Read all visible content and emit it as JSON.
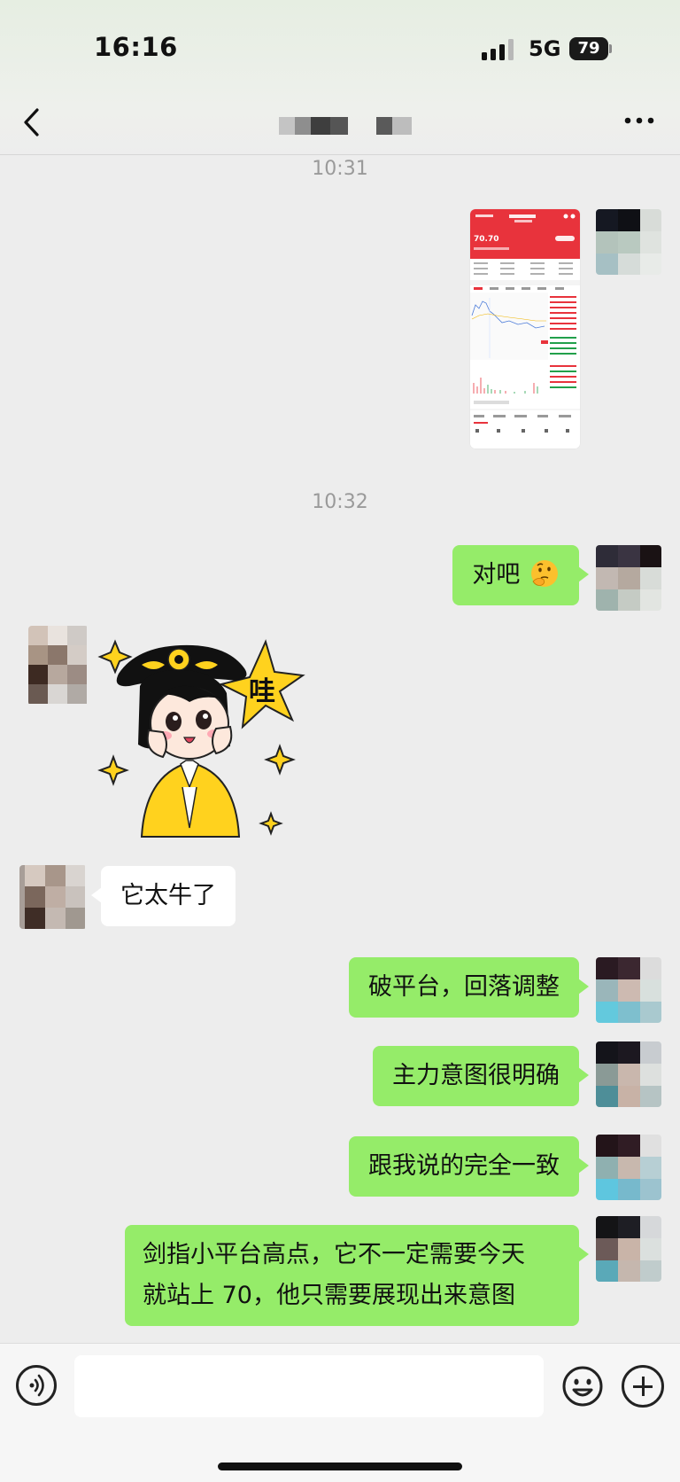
{
  "status_bar": {
    "time": "16:16",
    "network": "5G",
    "battery": "79"
  },
  "nav": {
    "title": ""
  },
  "timestamps": [
    "10:31",
    "10:32"
  ],
  "messages": {
    "m1": "对吧",
    "m2": "它太牛了",
    "m3": "破平台，回落调整",
    "m4": "主力意图很明确",
    "m5": "跟我说的完全一致",
    "m6_line1": "剑指小平台高点，它不一定需要今天",
    "m6_line2": "就站上 70，他只需要展现出来意图"
  },
  "screenshot_thumb": {
    "price": "70.70"
  },
  "sticker": {
    "text": "哇"
  },
  "input": {
    "placeholder": ""
  },
  "icons": {
    "back": "chevron-left-icon",
    "more": "more-dots-icon",
    "voice": "voice-icon",
    "emoji": "emoji-icon",
    "plus": "plus-icon",
    "thinking_emoji": "thinking-face-emoji"
  },
  "colors": {
    "bubble_right": "#95ec69",
    "bubble_left": "#ffffff",
    "background": "#ededed",
    "stock_red": "#e8333c"
  }
}
